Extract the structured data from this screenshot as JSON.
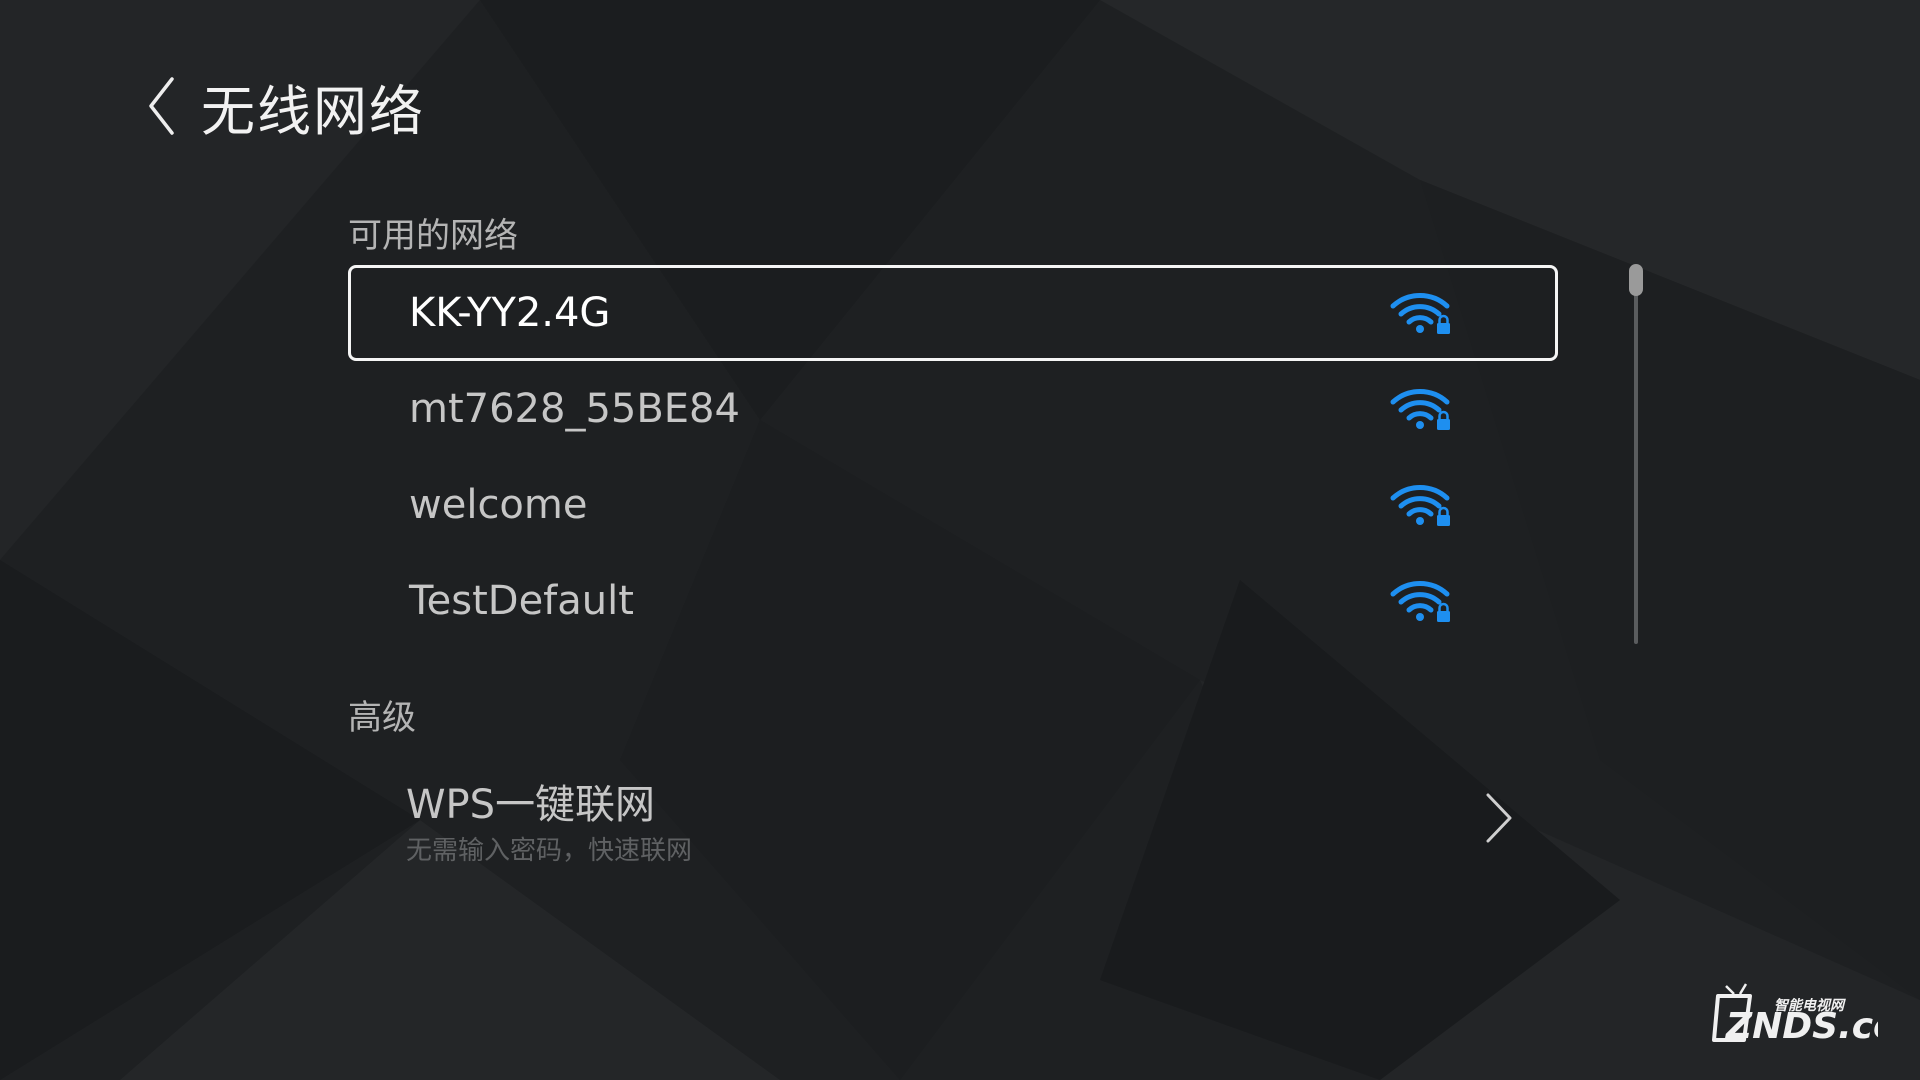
{
  "header": {
    "title": "无线网络",
    "back_icon": "chevron-left-icon"
  },
  "sections": {
    "available_label": "可用的网络",
    "advanced_label": "高级"
  },
  "networks": [
    {
      "name": "KK-YY2.4G",
      "focused": true,
      "icon": "wifi-lock-icon"
    },
    {
      "name": "mt7628_55BE84",
      "focused": false,
      "icon": "wifi-lock-icon"
    },
    {
      "name": "welcome",
      "focused": false,
      "icon": "wifi-lock-icon"
    },
    {
      "name": "TestDefault",
      "focused": false,
      "icon": "wifi-lock-icon"
    }
  ],
  "advanced": {
    "wps_title": "WPS一键联网",
    "wps_subtitle": "无需输入密码，快速联网",
    "icon": "chevron-right-icon"
  },
  "watermark": {
    "brand": "ZNDS.com",
    "tagline": "智能电视网"
  },
  "colors": {
    "accent": "#1e8ff0",
    "background": "#1e2022",
    "focus_border": "#f5f5f5"
  }
}
